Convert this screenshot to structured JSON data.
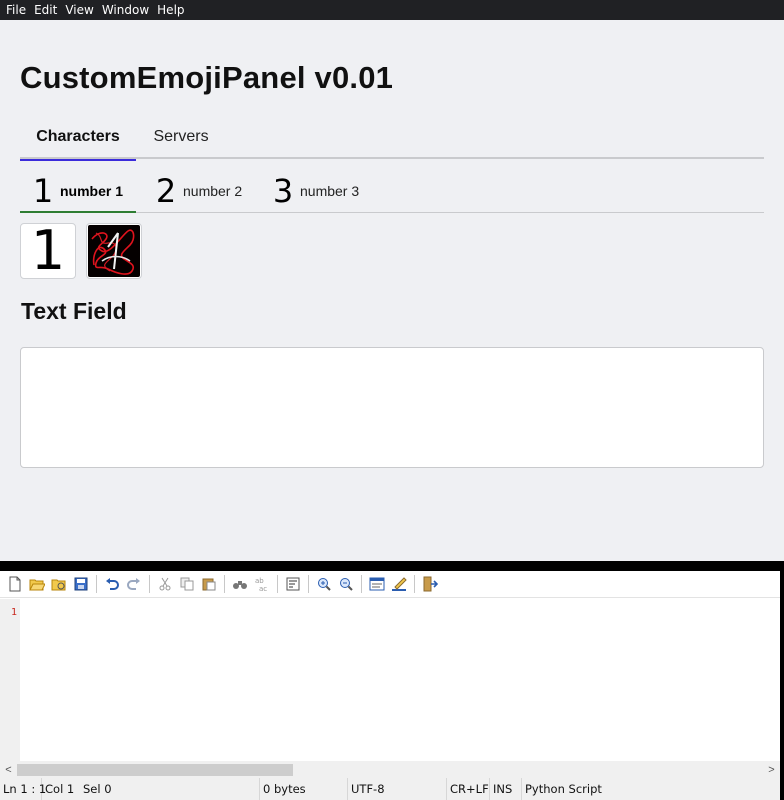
{
  "menubar": {
    "items": [
      "File",
      "Edit",
      "View",
      "Window",
      "Help"
    ]
  },
  "app": {
    "title": "CustomEmojiPanel v0.01",
    "main_tabs": [
      {
        "label": "Characters",
        "active": true
      },
      {
        "label": "Servers",
        "active": false
      }
    ],
    "sub_tabs": [
      {
        "glyph": "1",
        "label": "number 1",
        "active": true
      },
      {
        "glyph": "2",
        "label": "number 2",
        "active": false
      },
      {
        "glyph": "3",
        "label": "number 3",
        "active": false
      }
    ],
    "emojis": [
      {
        "glyph": "1",
        "kind": "text"
      },
      {
        "kind": "image",
        "icon": "red-scribble-one-icon"
      }
    ],
    "text_field": {
      "heading": "Text Field",
      "value": ""
    }
  },
  "editor": {
    "toolbar_icons": [
      "new-file-icon",
      "open-file-icon",
      "open-folder-icon",
      "save-icon",
      "undo-icon",
      "redo-icon",
      "cut-icon",
      "copy-icon",
      "paste-icon",
      "find-icon",
      "replace-icon",
      "wrap-icon",
      "zoom-in-icon",
      "zoom-out-icon",
      "properties-icon",
      "edit-icon",
      "exit-icon"
    ],
    "line_number": "1",
    "scroll_left": "<",
    "scroll_right": ">",
    "status": {
      "position": "Ln 1 : 1",
      "col": "Col 1",
      "sel": "Sel 0",
      "size": "0 bytes",
      "encoding": "UTF-8",
      "eol": "CR+LF",
      "mode": "INS",
      "language": "Python Script"
    }
  },
  "colors": {
    "menubar_bg": "#202124",
    "app_bg": "#eff0f3",
    "main_tab_accent": "#3b2bdb",
    "sub_tab_accent": "#2e7d32",
    "line_number": "#c8281e"
  }
}
